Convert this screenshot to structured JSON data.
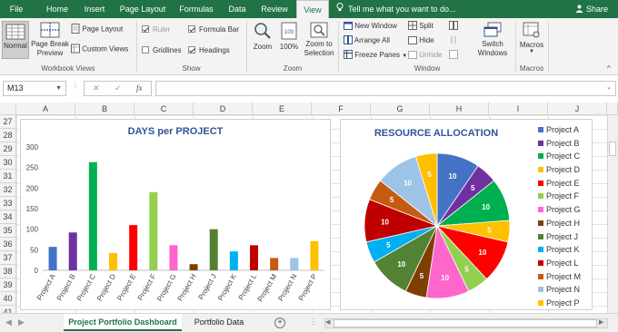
{
  "ribbon_tabs": [
    "File",
    "Home",
    "Insert",
    "Page Layout",
    "Formulas",
    "Data",
    "Review",
    "View"
  ],
  "active_tab": "View",
  "tell_me": "Tell me what you want to do...",
  "share": "Share",
  "ribbon": {
    "workbook_views": {
      "normal": "Normal",
      "page_break_preview": [
        "Page Break",
        "Preview"
      ],
      "page_layout": "Page Layout",
      "custom_views": "Custom Views",
      "label": "Workbook Views"
    },
    "show": {
      "ruler": "Ruler",
      "formula_bar": "Formula Bar",
      "gridlines": "Gridlines",
      "headings": "Headings",
      "label": "Show"
    },
    "zoom": {
      "zoom": "Zoom",
      "hundred": "100%",
      "zoom_to_selection": [
        "Zoom to",
        "Selection"
      ],
      "label": "Zoom"
    },
    "window": {
      "new_window": "New Window",
      "arrange_all": "Arrange All",
      "freeze_panes": "Freeze Panes",
      "split": "Split",
      "hide": "Hide",
      "unhide": "Unhide",
      "switch_windows": [
        "Switch",
        "Windows"
      ],
      "label": "Window"
    },
    "macros": {
      "macros": "Macros",
      "label": "Macros"
    }
  },
  "formula_bar": {
    "name_box": "M13",
    "cancel": "✕",
    "enter": "✓",
    "fx": "fx",
    "formula": ""
  },
  "columns": [
    "A",
    "B",
    "C",
    "D",
    "E",
    "F",
    "G",
    "H",
    "I",
    "J"
  ],
  "rows": [
    "27",
    "28",
    "29",
    "30",
    "31",
    "32",
    "33",
    "34",
    "35",
    "36",
    "37",
    "38",
    "39",
    "40",
    "41"
  ],
  "colors": {
    "excel_green": "#217346",
    "chart_title": "#2f5597"
  },
  "chart_data": [
    {
      "type": "bar",
      "title": "DAYS per PROJECT",
      "categories": [
        "Project A",
        "Project B",
        "Project C",
        "Project D",
        "Project E",
        "Project F",
        "Project G",
        "Project H",
        "Project J",
        "Project K",
        "Project L",
        "Project M",
        "Project N",
        "Project P"
      ],
      "values": [
        57,
        92,
        263,
        42,
        110,
        190,
        61,
        15,
        100,
        46,
        61,
        30,
        30,
        71
      ],
      "colors": [
        "#4472c4",
        "#7030a0",
        "#00b050",
        "#ffc000",
        "#ff0000",
        "#92d050",
        "#ff66cc",
        "#7f3f00",
        "#548235",
        "#00b0f0",
        "#c00000",
        "#c55a11",
        "#9dc3e6",
        "#ffc000"
      ],
      "yticks": [
        0,
        50,
        100,
        150,
        200,
        250,
        300
      ],
      "ylim": [
        0,
        300
      ],
      "xlabel": "",
      "ylabel": "",
      "grid": false,
      "legend": "none"
    },
    {
      "type": "pie",
      "title": "RESOURCE ALLOCATION",
      "labels": [
        "Project A",
        "Project B",
        "Project C",
        "Project D",
        "Project E",
        "Project F",
        "Project G",
        "Project H",
        "Project J",
        "Project K",
        "Project L",
        "Project M",
        "Project N",
        "Project P"
      ],
      "values": [
        10,
        5,
        10,
        5,
        10,
        5,
        10,
        5,
        10,
        5,
        10,
        5,
        10,
        5
      ],
      "colors": [
        "#4472c4",
        "#7030a0",
        "#00b050",
        "#ffc000",
        "#ff0000",
        "#92d050",
        "#ff66cc",
        "#7f3f00",
        "#548235",
        "#00b0f0",
        "#c00000",
        "#c55a11",
        "#9dc3e6",
        "#ffc000"
      ],
      "legend": "right"
    }
  ],
  "sheets": [
    "Project Portfolio Dashboard",
    "Portfolio Data"
  ],
  "active_sheet": "Project Portfolio Dashboard"
}
